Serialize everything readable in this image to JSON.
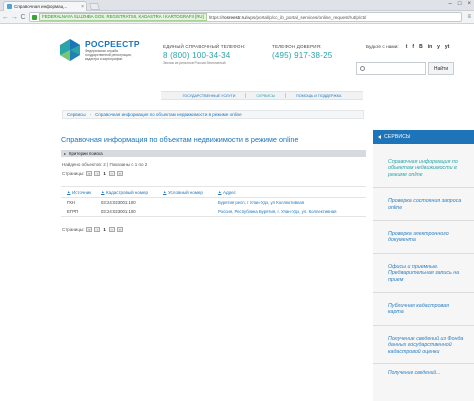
{
  "browser": {
    "tab_title": "Справочная информац...",
    "tab_close": "×",
    "window_buttons": [
      "–",
      "□",
      "×"
    ],
    "back_glyph": "←",
    "forward_glyph": "→",
    "reload_glyph": "C",
    "menu_glyph": "≡",
    "ev_label": "FEDERALNAYA SLUZHBA GOS. REGISTRATSII, KADASTRA I KARTOGRAFII [RU]",
    "url_scheme": "https://",
    "url_host": "rosreestr.ru",
    "url_path": "/wps/portal/p/cc_ib_portal_services/online_request/!ut/p/c5/"
  },
  "header": {
    "brand_name": "РОСРЕЕСТР",
    "brand_sub": "Федеральная служба государственной регистрации, кадастра и картографии",
    "phone1_label": "Единый справочный телефон:",
    "phone1_number": "8 (800) 100-34-34",
    "phone1_note": "Звонок из регионов России бесплатный",
    "phone2_label": "Телефон доверия:",
    "phone2_number": "(495) 917-38-25",
    "social_label": "Будьте с нами:",
    "social_icons": [
      "t",
      "f",
      "B",
      "in",
      "y",
      "yt"
    ],
    "search_button": "Найти",
    "search_value": ""
  },
  "topnav": {
    "items": [
      "Государственные услуги",
      "Сервисы",
      "Помощь и поддержка"
    ]
  },
  "breadcrumbs": [
    "Сервисы",
    "Справочная информация по объектам недвижимости в режиме online"
  ],
  "main": {
    "title": "Справочная информация по объектам недвижимости в режиме online",
    "criteria_label": "Критерии поиска",
    "found_text": "Найдено объектов: 2 | Показаны с 1 по 2",
    "pager_label": "Страницы:",
    "pager_current": "1",
    "columns": [
      "Источник",
      "Кадастровый номер",
      "Условный номер",
      "Адрес"
    ],
    "rows": [
      {
        "source": "ГКН",
        "cadastral": "03:24:023001:100",
        "conditional": "",
        "address": "Бурятия респ, г Улан-Удэ, ул Коллективная"
      },
      {
        "source": "ЕГРП",
        "cadastral": "03:24:023001:100",
        "conditional": "",
        "address": "Россия, Республика Бурятия, г. Улан-Удэ, ул. Коллективная"
      }
    ]
  },
  "sidebar": {
    "title": "Сервисы",
    "items": [
      "Справочная информация по объектам недвижимости в режиме online",
      "Проверка состояния запроса online",
      "Проверка электронного документа",
      "Офисы и приемные. Предварительная запись на прием",
      "Публичная кадастровая карта",
      "Получение сведений из Фонда данных государственной кадастровой оценки"
    ],
    "more": "Получение сведений..."
  },
  "colors": {
    "brand_blue": "#1d74b8",
    "accent_teal": "#2aa4a9"
  }
}
